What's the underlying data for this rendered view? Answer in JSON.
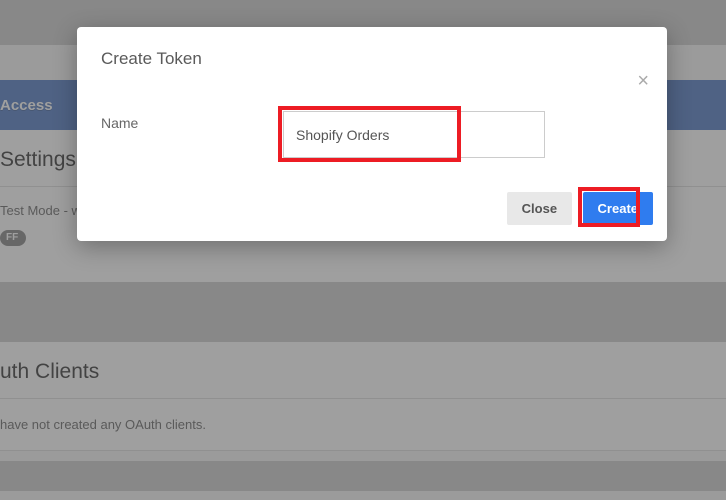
{
  "background": {
    "blueband_label": "Access",
    "settings_title": "Settings",
    "test_mode_label": "Test Mode - w",
    "off_pill": "FF",
    "oauth_title": "uth Clients",
    "no_clients_text": "have not created any OAuth clients."
  },
  "modal": {
    "title": "Create Token",
    "close_glyph": "×",
    "name_label": "Name",
    "name_value": "Shopify Orders",
    "close_button": "Close",
    "create_button": "Create"
  }
}
